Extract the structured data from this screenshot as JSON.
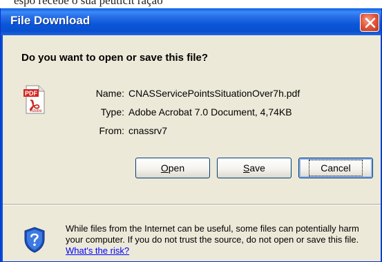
{
  "background_text": "espo recebe o sua peuticit ração",
  "window": {
    "title": "File Download"
  },
  "dialog": {
    "question": "Do you want to open or save this file?",
    "file_icon": "pdf-file-icon",
    "file_icon_badge": "PDF",
    "file_icon_brand": "Adobe",
    "info": {
      "name_label": "Name:",
      "name_value": "CNASServicePointsSituationOver7h.pdf",
      "type_label": "Type:",
      "type_value": "Adobe Acrobat 7.0 Document, 4,74KB",
      "from_label": "From:",
      "from_value": "cnassrv7"
    },
    "buttons": {
      "open_accel": "O",
      "open_rest": "pen",
      "save_accel": "S",
      "save_rest": "ave",
      "cancel": "Cancel"
    },
    "warning": {
      "icon": "security-shield-icon",
      "text": "While files from the Internet can be useful, some files can potentially harm your computer. If you do not trust the source, do not open or save this file.",
      "link": "What's the risk?"
    }
  },
  "colors": {
    "titlebar": "#0a4fd0",
    "client_background": "#ece9d8",
    "close_button": "#e2583e",
    "link": "#0000ff"
  }
}
